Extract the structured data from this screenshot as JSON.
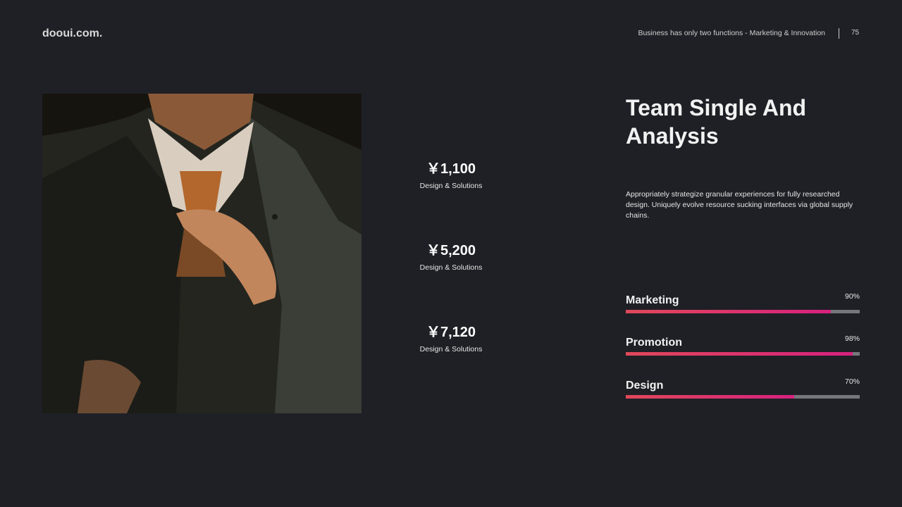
{
  "header": {
    "logo": "dooui.com.",
    "tagline": "Business has only two functions - Marketing & Innovation",
    "page_number": "75"
  },
  "stats": [
    {
      "value": "￥1,100",
      "label": "Design & Solutions"
    },
    {
      "value": "￥5,200",
      "label": "Design & Solutions"
    },
    {
      "value": "￥7,120",
      "label": "Design & Solutions"
    }
  ],
  "content": {
    "title": "Team Single And Analysis",
    "description": "Appropriately strategize granular experiences for fully researched design. Uniquely  evolve resource sucking interfaces via global supply chains."
  },
  "skills": [
    {
      "label": "Marketing",
      "percent_text": "90%",
      "value": 0.875
    },
    {
      "label": "Promotion",
      "percent_text": "98%",
      "value": 0.97
    },
    {
      "label": "Design",
      "percent_text": "70%",
      "value": 0.72
    }
  ],
  "colors": {
    "background": "#1f2026",
    "bar_start": "#e0485a",
    "bar_end": "#d7217f",
    "track": "#76767b"
  }
}
